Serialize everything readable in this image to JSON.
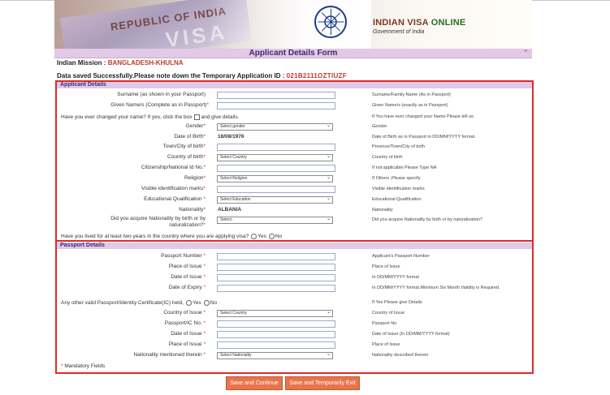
{
  "banner": {
    "card_country": "REPUBLIC OF INDIA",
    "card_word": "VISA",
    "logo_part1": "INDIAN VISA",
    "logo_part2": "ONLINE",
    "logo_sub": "Government of India"
  },
  "title": "Applicant Details Form",
  "mission_label": "Indian Mission :",
  "mission_value": "BANGLADESH-KHULNA",
  "saved_label": "Data saved Successfully.Please note down the Temporary Application ID :",
  "saved_value": "021B2111OZTIUZF",
  "applicant": {
    "heading": "Applicant Details",
    "surname": {
      "label": "Surname (as shown in your Passport)",
      "help": "Surname/Family Name (As in Passport)"
    },
    "given": {
      "label": "Given Name/s (Complete as in Passport)",
      "help": "Given Name/s (exactly as in Passport)"
    },
    "changed": {
      "label_a": "Have you ever changed your name? If yes, click the box",
      "label_b": "and give details.",
      "help": "If You have ever changed your Name Please tell us."
    },
    "gender": {
      "label": "Gender",
      "value": "Select gender",
      "help": "Gender"
    },
    "dob": {
      "label": "Date of Birth",
      "value": "18/08/1976",
      "help": "Date of Birth as in Passport in DD/MM/YYYY format."
    },
    "town": {
      "label": "Town/City of birth",
      "help": "Province/Town/City of birth"
    },
    "country_birth": {
      "label": "Country of birth",
      "value": "Select Country",
      "help": "Country of birth"
    },
    "citizenship": {
      "label": "Citizenship/National Id No.",
      "help": "If not applicable Please Type NA"
    },
    "religion": {
      "label": "Religion",
      "value": "Select Religion",
      "help": "If Others ,Please specify"
    },
    "marks": {
      "label": "Visible identification marks",
      "help": "Visible identification marks"
    },
    "education": {
      "label": "Educational Qualification",
      "value": "Select Education",
      "help": "Educational Qualification"
    },
    "nationality": {
      "label": "Nationality",
      "value": "ALBANIA",
      "help": "Nationality"
    },
    "acquire": {
      "label_a": "Did you acquire Nationality by birth or by",
      "label_b": "naturalization?",
      "value": "Select..",
      "help": "Did you acquire Nationality by birth or by naturalization?"
    },
    "lived": {
      "label": "Have you lived for at least two years in the country where you are applying visa?",
      "yes": "Yes",
      "no": "No"
    }
  },
  "passport": {
    "heading": "Passport Details",
    "number": {
      "label": "Passport Number",
      "help": "Applicant's Passport Number"
    },
    "place": {
      "label": "Place of Issue",
      "help": "Place of Issue"
    },
    "date_issue": {
      "label": "Date of Issue",
      "help": "In DD/MM/YYYY format"
    },
    "date_expiry": {
      "label": "Date of Expiry",
      "help": "In DD/MM/YYYY format.Minimum Six Month Validity is Required."
    },
    "other": {
      "label": "Any other valid Passport/Identity Certificate(IC) held,",
      "yes": "Yes",
      "no": "No",
      "help": "If Yes Please give Details"
    },
    "country_issue": {
      "label": "Country of Issue",
      "value": "Select Country",
      "help": "Country of Issue"
    },
    "ic_no": {
      "label": "Passport/IC No.",
      "help": "Passport No"
    },
    "ic_date": {
      "label": "Date of Issue",
      "help": "Date of Issue (In DD/MM/YYYY format)"
    },
    "ic_place": {
      "label": "Place of Issue",
      "help": "Place of Issue"
    },
    "nat_therein": {
      "label": "Nationality mentioned therein",
      "value": "Select Nationality",
      "help": "Nationality described therein"
    }
  },
  "mandatory": "Mandatory Fields",
  "buttons": {
    "save_continue": "Save and Continue",
    "save_exit": "Save and Temporarily Exit"
  },
  "colors": {
    "accent_red": "#e02a2a",
    "section_bg": "#e2c9e6",
    "button": "#e9744b"
  }
}
